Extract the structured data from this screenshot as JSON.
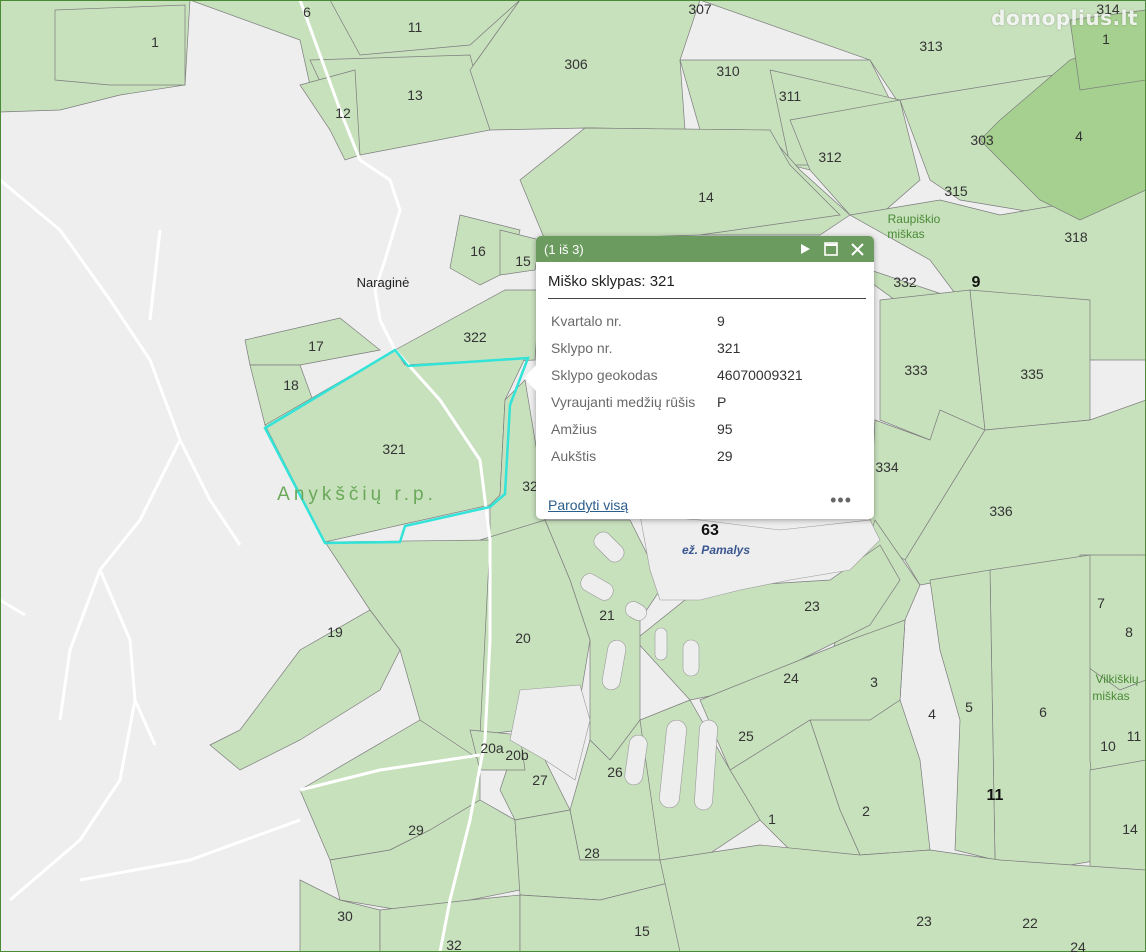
{
  "watermark": "domoplius.lt",
  "map": {
    "parcel_labels": [
      "1",
      "6",
      "11",
      "13",
      "12",
      "307",
      "306",
      "310",
      "311",
      "313",
      "314",
      "1",
      "4",
      "303",
      "312",
      "315",
      "14",
      "16",
      "15",
      "17",
      "18",
      "322",
      "321",
      "32",
      "318",
      "332",
      "333",
      "335",
      "334",
      "336",
      "7",
      "8",
      "10",
      "11",
      "14",
      "5",
      "6",
      "4",
      "3",
      "2",
      "1",
      "23",
      "24",
      "25",
      "26",
      "27",
      "21",
      "20",
      "20a",
      "20b",
      "19",
      "29",
      "28",
      "30",
      "32",
      "15",
      "23",
      "22",
      "24"
    ],
    "quarter_labels": [
      "9",
      "63",
      "11"
    ],
    "place_labels": [
      "Naraginė"
    ],
    "forest_labels": [
      "Raupiškio",
      "miškas",
      "Vilkiškių",
      "miškas"
    ],
    "district_label": "Anykščių r.p.",
    "lake_label": "ež. Pamalys"
  },
  "popup": {
    "counter": "(1 iš 3)",
    "title": "Miško sklypas: 321",
    "rows": [
      {
        "key": "Kvartalo nr.",
        "value": "9"
      },
      {
        "key": "Sklypo nr.",
        "value": "321"
      },
      {
        "key": "Sklypo geokodas",
        "value": "46070009321"
      },
      {
        "key": "Vyraujanti medžių rūšis",
        "value": "P"
      },
      {
        "key": "Amžius",
        "value": "95"
      },
      {
        "key": "Aukštis",
        "value": "29"
      }
    ],
    "link": "Parodyti visą",
    "more": "•••"
  },
  "colors": {
    "forest": "#c8e1bd",
    "forest_dark": "#a6d08f",
    "background": "#eeeeee",
    "highlight": "#32e3d8",
    "header": "#6b9b5e"
  }
}
